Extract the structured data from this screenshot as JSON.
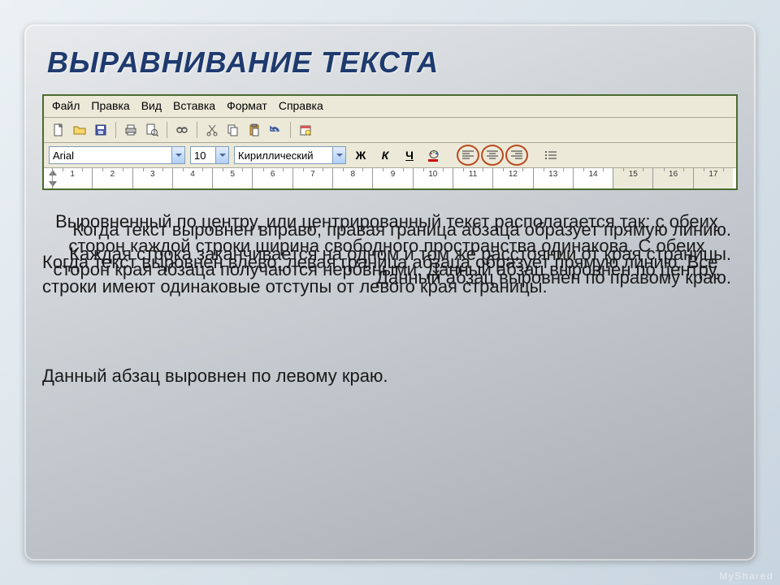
{
  "title": "ВЫРАВНИВАНИЕ ТЕКСТА",
  "menu": {
    "file": "Файл",
    "edit": "Правка",
    "view": "Вид",
    "insert": "Вставка",
    "format": "Формат",
    "help": "Справка"
  },
  "format_bar": {
    "font": "Arial",
    "size": "10",
    "script": "Кириллический",
    "bold": "Ж",
    "italic": "К",
    "underline": "Ч"
  },
  "ruler": {
    "numbers": [
      "1",
      "2",
      "3",
      "4",
      "5",
      "6",
      "7",
      "8",
      "9",
      "10",
      "11",
      "12",
      "13",
      "14",
      "15",
      "16",
      "17"
    ]
  },
  "paragraphs": {
    "center": "Выровненный по центру, или центрированный текст располагается так: с обеих сторон каждой строки ширина свободного пространства одинакова. С обеих сторон края абзаца получаются неровными. Данный абзац выровнен по центру.",
    "right": "Когда текст выровнен вправо, правая граница абзаца образует прямую линию. Каждая строка заканчивается на одном и том же расстоянии от края страницы. Данный абзац выровнен по правому краю.",
    "left": "Когда текст выровнен влево, левая граница абзаца образует прямую линию. Все строки имеют одинаковые отступы от левого края страницы.",
    "left2": "Данный абзац выровнен по левому краю."
  },
  "watermark": "MyShared"
}
